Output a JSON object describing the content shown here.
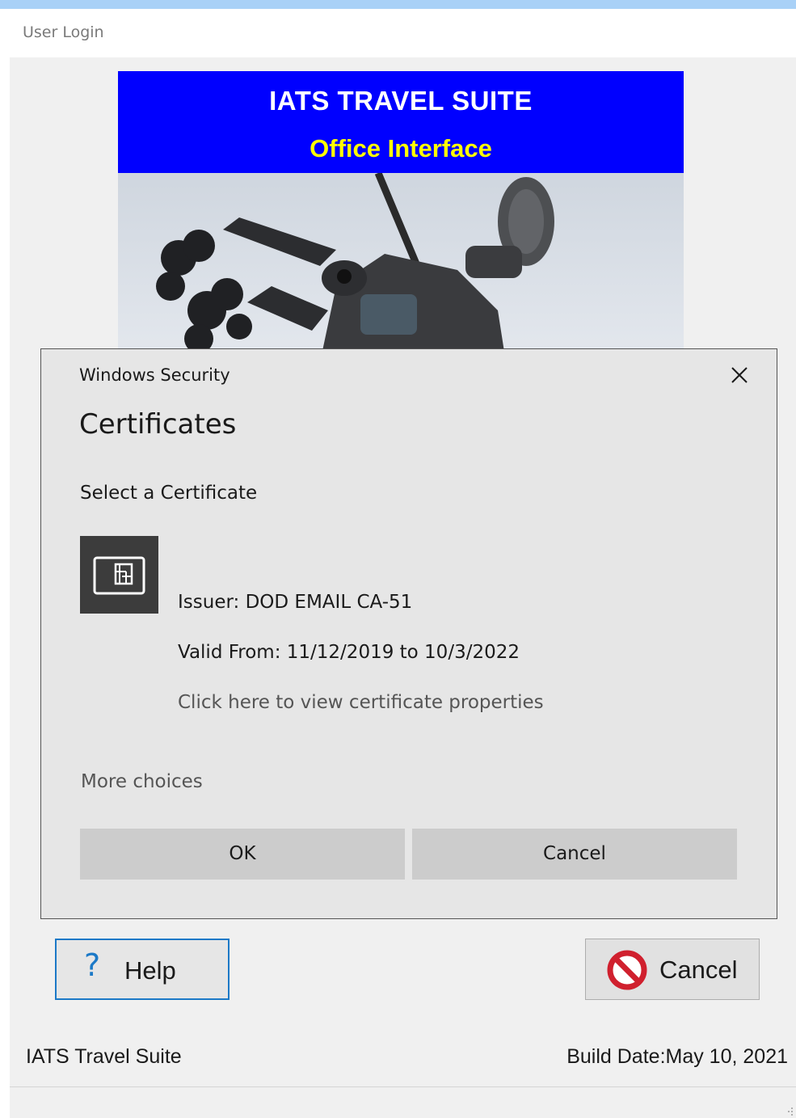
{
  "window": {
    "title": "User Login"
  },
  "banner": {
    "title": "IATS TRAVEL SUITE",
    "subtitle": "Office Interface"
  },
  "dialog": {
    "heading": "Windows Security",
    "title": "Certificates",
    "prompt": "Select a Certificate",
    "certificate": {
      "issuer": "Issuer: DOD EMAIL CA-51",
      "valid": "Valid From: 11/12/2019 to 10/3/2022",
      "properties_link": "Click here to view certificate properties"
    },
    "more_choices": "More choices",
    "ok_label": "OK",
    "cancel_label": "Cancel"
  },
  "buttons": {
    "help_label": "Help",
    "cancel_label": "Cancel"
  },
  "footer": {
    "app_name": "IATS Travel Suite",
    "build_date": "Build Date:May 10, 2021"
  },
  "colors": {
    "accent": "#1c79c7",
    "banner_blue": "#0000ff",
    "banner_yellow": "#ffff00",
    "dialog_bg": "#e6e6e6",
    "button_gray": "#cccccc"
  },
  "icons": [
    "close-icon",
    "certificate-card-icon",
    "help-icon",
    "cancel-prohibited-icon",
    "resize-grip-icon"
  ]
}
